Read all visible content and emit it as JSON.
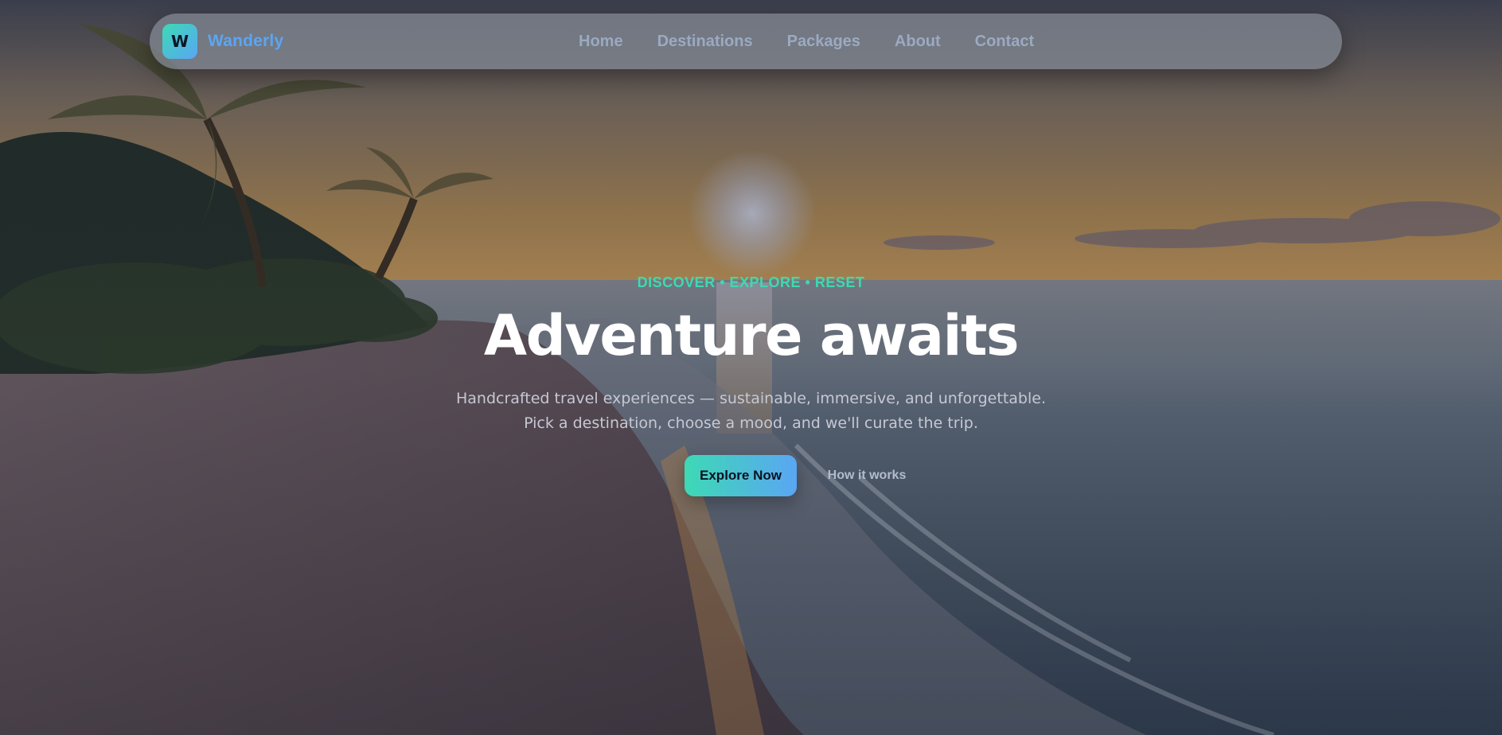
{
  "brand": {
    "logo_letter": "W",
    "name": "Wanderly",
    "accent_from": "#3dd9b5",
    "accent_to": "#5aa6f3"
  },
  "nav": {
    "items": [
      {
        "label": "Home"
      },
      {
        "label": "Destinations"
      },
      {
        "label": "Packages"
      },
      {
        "label": "About"
      },
      {
        "label": "Contact"
      }
    ]
  },
  "hero": {
    "background": "beach-sunset-photo",
    "eyebrow": "DISCOVER • EXPLORE • RESET",
    "headline": "Adventure awaits",
    "subcopy": "Handcrafted travel experiences — sustainable, immersive, and unforgettable. Pick a destination, choose a mood, and we'll curate the trip.",
    "primary_cta": "Explore Now",
    "secondary_cta": "How it works"
  }
}
